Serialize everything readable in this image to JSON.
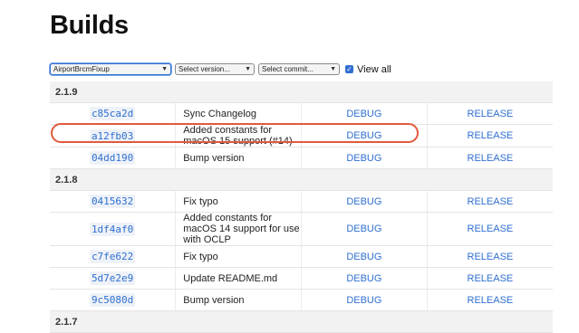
{
  "page": {
    "title": "Builds"
  },
  "controls": {
    "project_select": "AirportBrcmFixup",
    "version_select": "Select version...",
    "commit_select": "Select commit...",
    "view_all_label": "View all"
  },
  "groups": [
    {
      "version": "2.1.9",
      "builds": [
        {
          "hash": "c85ca2d",
          "message": "Sync Changelog",
          "debug": "DEBUG",
          "release": "RELEASE"
        },
        {
          "hash": "a12fb03",
          "message": "Added constants for macOS 15 support (#14)",
          "debug": "DEBUG",
          "release": "RELEASE"
        },
        {
          "hash": "04dd190",
          "message": "Bump version",
          "debug": "DEBUG",
          "release": "RELEASE"
        }
      ]
    },
    {
      "version": "2.1.8",
      "builds": [
        {
          "hash": "0415632",
          "message": "Fix typo",
          "debug": "DEBUG",
          "release": "RELEASE"
        },
        {
          "hash": "1df4af0",
          "message": "Added constants for macOS 14 support for use with OCLP",
          "debug": "DEBUG",
          "release": "RELEASE"
        },
        {
          "hash": "c7fe622",
          "message": "Fix typo",
          "debug": "DEBUG",
          "release": "RELEASE"
        },
        {
          "hash": "5d7e2e9",
          "message": "Update README.md",
          "debug": "DEBUG",
          "release": "RELEASE"
        },
        {
          "hash": "9c5080d",
          "message": "Bump version",
          "debug": "DEBUG",
          "release": "RELEASE"
        }
      ]
    },
    {
      "version": "2.1.7",
      "builds": []
    }
  ],
  "colors": {
    "link": "#2f6fd1",
    "highlight": "#e05a3c"
  }
}
